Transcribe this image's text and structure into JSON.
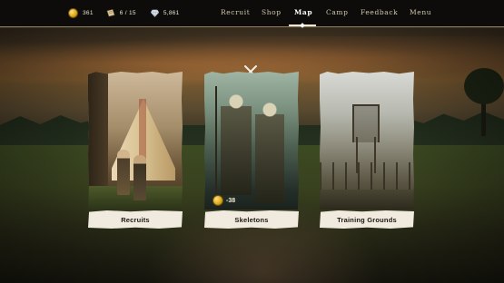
{
  "resources": {
    "gold": "361",
    "units": "6 / 15",
    "gems": "5,861"
  },
  "nav": {
    "items": [
      "Recruit",
      "Shop",
      "Map",
      "Camp",
      "Feedback",
      "Menu"
    ],
    "active": "Map"
  },
  "cards": [
    {
      "label": "Recruits"
    },
    {
      "label": "Skeletons",
      "cost": "-38"
    },
    {
      "label": "Training Grounds"
    }
  ],
  "icons": {
    "gold": "coin-icon",
    "units": "scroll-icon",
    "gems": "diamond-icon",
    "close": "close-icon"
  },
  "colors": {
    "topbar": "#0d0c0a",
    "gold": "#d9a419",
    "card_label_bg": "#f1ebdf",
    "nav_active": "#ffffff"
  }
}
